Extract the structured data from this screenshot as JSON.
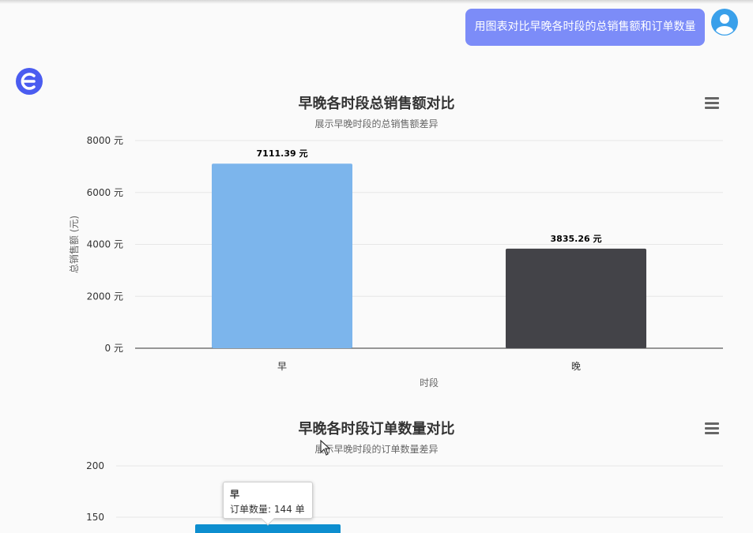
{
  "chat": {
    "user_message": "用图表对比早晚各时段的总销售额和订单数量"
  },
  "chart1_header": {
    "title": "早晚各时段总销售额对比",
    "subtitle": "展示早晚时段的总销售额差异"
  },
  "chart2_header": {
    "title": "早晚各时段订单数量对比",
    "subtitle": "展示早晚时段的订单数量差异"
  },
  "chart_data": [
    {
      "type": "bar",
      "title": "早晚各时段总销售额对比",
      "subtitle": "展示早晚时段的总销售额差异",
      "categories": [
        "早",
        "晚"
      ],
      "values": [
        7111.39,
        3835.26
      ],
      "data_labels": [
        "7111.39 元",
        "3835.26 元"
      ],
      "colors": [
        "#7cb5ec",
        "#434348"
      ],
      "xlabel": "时段",
      "ylabel": "总销售额 (元)",
      "ylim": [
        0,
        8000
      ],
      "yticks": [
        0,
        2000,
        4000,
        6000,
        8000
      ],
      "ytick_labels": [
        "0 元",
        "2000 元",
        "4000 元",
        "6000 元",
        "8000 元"
      ],
      "grid": true
    },
    {
      "type": "bar",
      "title": "早晚各时段订单数量对比",
      "subtitle": "展示早晚时段的订单数量差异",
      "categories": [
        "早"
      ],
      "values": [
        144
      ],
      "colors": [
        "#0d8ecf"
      ],
      "yticks": [
        150,
        200
      ],
      "ytick_labels": [
        "150",
        "200"
      ],
      "grid": true
    }
  ],
  "tooltip": {
    "title": "早",
    "text": "订单数量: 144 单"
  },
  "icons": {
    "avatar": "user-avatar-icon",
    "bot": "bot-logo-icon",
    "menu": "hamburger-menu-icon"
  },
  "colors": {
    "user_bubble": "#7c8cf8",
    "avatar": "#3aa0ea",
    "bot_logo": "#4a5cf0"
  }
}
